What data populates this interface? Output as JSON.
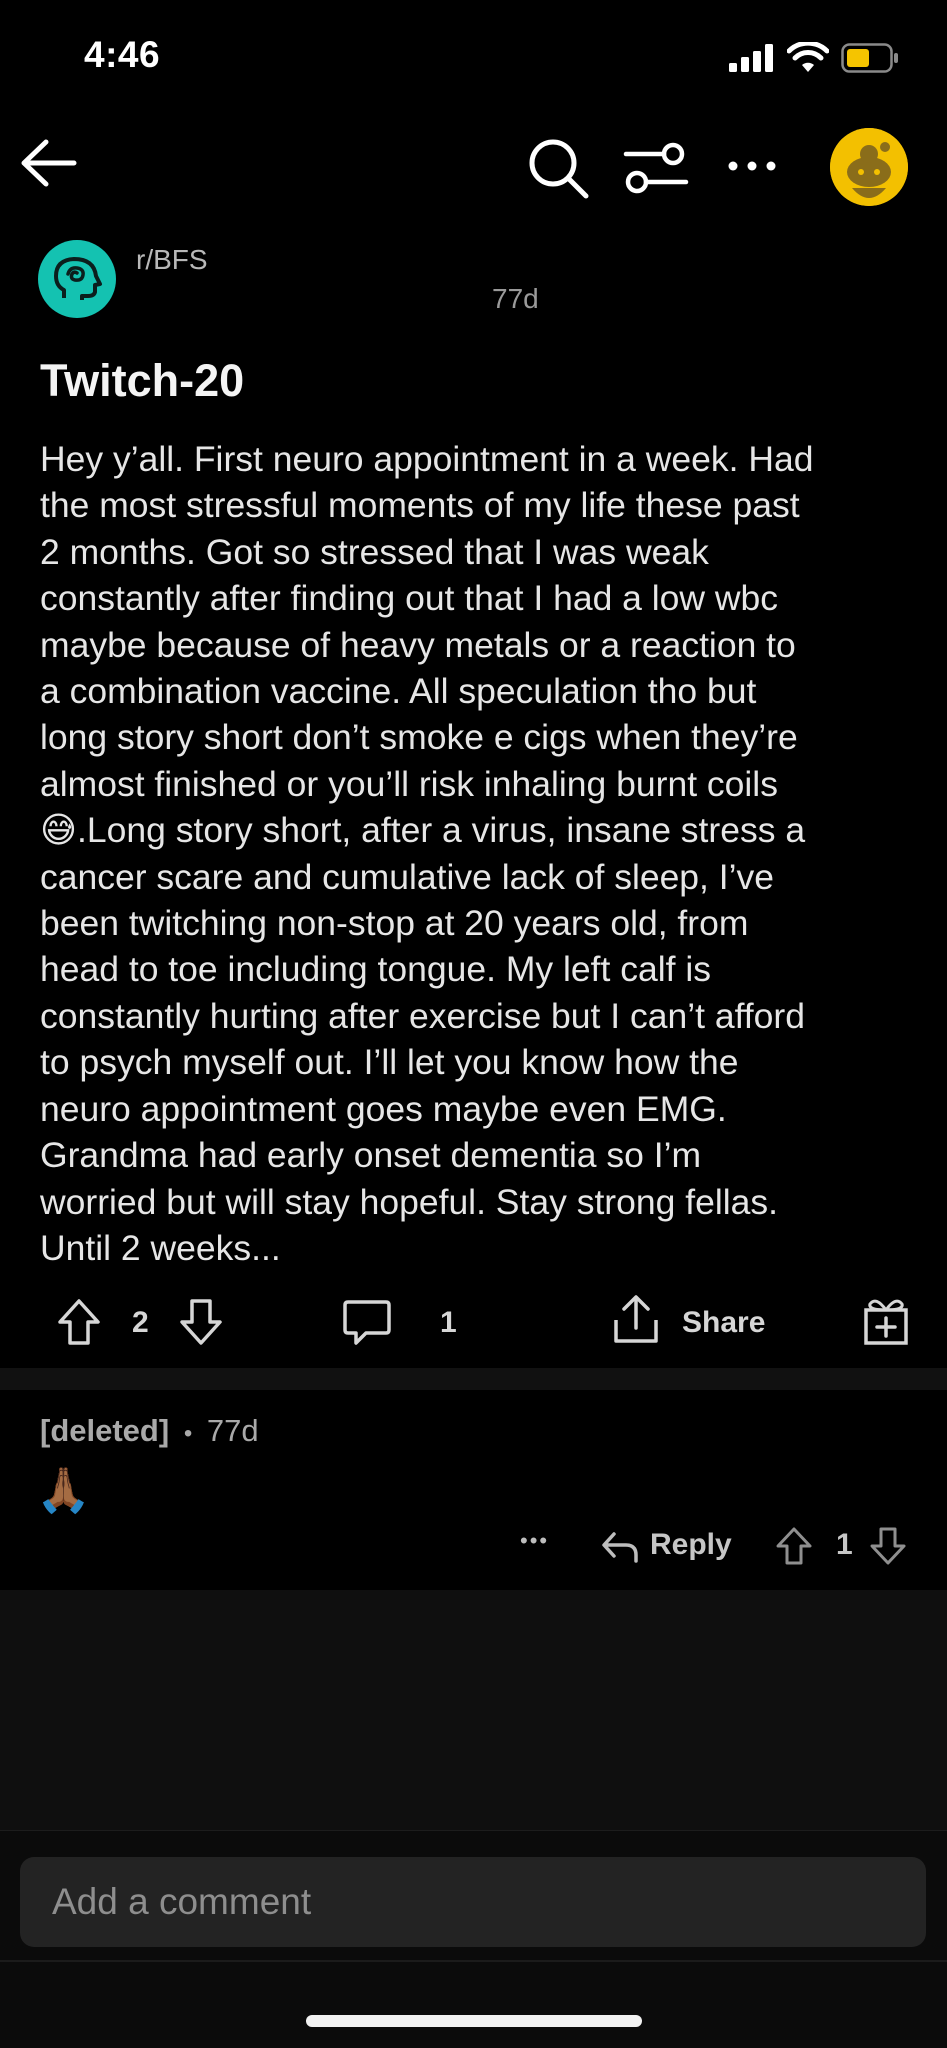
{
  "status_bar": {
    "time": "4:46",
    "battery_color": "#f5c400"
  },
  "nav": {
    "back_icon": "arrow-left-icon",
    "search_icon": "search-icon",
    "filter_icon": "sort-sliders-icon",
    "more_icon": "ellipsis-icon",
    "avatar_icon": "reddit-snoo-avatar"
  },
  "post": {
    "subreddit": "r/BFS",
    "age": "77d",
    "title": "Twitch-20",
    "body_before_emoji": "Hey y’all. First neuro appointment in a week. Had\nthe most stressful moments of my life these past\n2 months. Got so stressed that I was weak\nconstantly after finding out that I had a low wbc\nmaybe because of heavy metals or a reaction to\na combination vaccine. All speculation tho but\nlong story short don’t smoke e cigs when they’re\nalmost finished or you’ll risk inhaling burnt coils\n",
    "emoji": "😅",
    "body_after_emoji": ".Long story short, after a virus, insane stress a\ncancer scare and cumulative lack of sleep, I’ve\nbeen twitching non-stop at 20 years old, from\nhead to toe including tongue. My left calf is\nconstantly hurting after exercise but I can’t afford\nto psych myself out. I’ll let you know how the\nneuro appointment goes maybe even EMG.\nGrandma had early onset dementia so I’m\nworried but will stay hopeful. Stay strong fellas.\nUntil 2 weeks...",
    "vote_count": "2",
    "comment_count": "1",
    "share_label": "Share",
    "subreddit_color": "#14c2b1"
  },
  "comment": {
    "author": "[deleted]",
    "separator": "•",
    "age": "77d",
    "emoji": "🙏🏾",
    "more": "•••",
    "reply_label": "Reply",
    "vote_count": "1"
  },
  "composer": {
    "placeholder": "Add a comment"
  }
}
